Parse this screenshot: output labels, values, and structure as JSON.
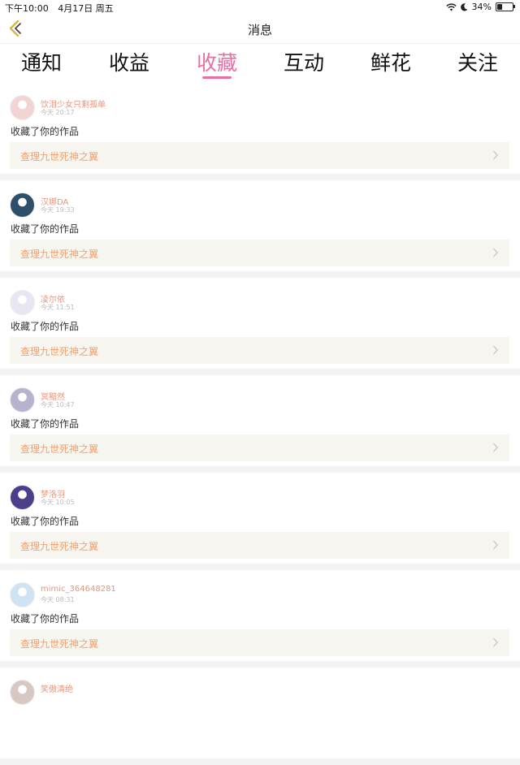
{
  "status": {
    "time": "下午10:00",
    "date": "4月17日 周五",
    "battery": "34%",
    "battery_level": 0.34
  },
  "nav": {
    "title": "消息"
  },
  "tabs": [
    {
      "label": "通知"
    },
    {
      "label": "收益"
    },
    {
      "label": "收藏",
      "active": true
    },
    {
      "label": "互动"
    },
    {
      "label": "鲜花"
    },
    {
      "label": "关注"
    }
  ],
  "items": [
    {
      "user": "饮泪少女只剩孤单",
      "time": "今天 20:17",
      "action": "收藏了你的作品",
      "work": "查理九世死神之翼",
      "avatar_color": "#f3d4d4"
    },
    {
      "user": "汉娜DA",
      "time": "今天 19:33",
      "action": "收藏了你的作品",
      "work": "查理九世死神之翼",
      "avatar_color": "#2d4f6a"
    },
    {
      "user": "凌尔依",
      "time": "今天 11:51",
      "action": "收藏了你的作品",
      "work": "查理九世死神之翼",
      "avatar_color": "#e8e6f3"
    },
    {
      "user": "冥黯然",
      "time": "今天 10:47",
      "action": "收藏了你的作品",
      "work": "查理九世死神之翼",
      "avatar_color": "#b9b2cf"
    },
    {
      "user": "梦洛羽",
      "time": "今天 10:05",
      "action": "收藏了你的作品",
      "work": "查理九世死神之翼",
      "avatar_color": "#4d3e8c"
    },
    {
      "user": "mimic_364648281",
      "time": "今天 08:31",
      "action": "收藏了你的作品",
      "work": "查理九世死神之翼",
      "avatar_color": "#cfe3f3"
    },
    {
      "user": "笑傲清绝",
      "time": "",
      "action": "",
      "work": "",
      "avatar_color": "#d8c8c4"
    }
  ]
}
